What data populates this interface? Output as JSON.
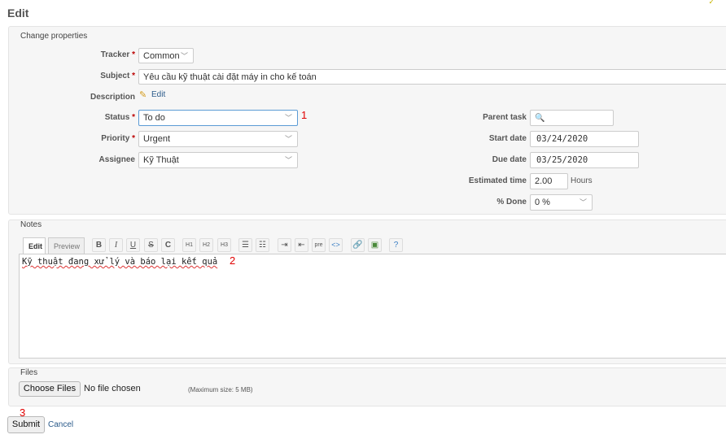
{
  "page": {
    "title": "Edit"
  },
  "properties": {
    "legend": "Change properties",
    "tracker": {
      "label": "Tracker",
      "value": "Common"
    },
    "subject": {
      "label": "Subject",
      "value": "Yêu cầu kỹ thuật cài đặt máy in cho kế toán"
    },
    "description": {
      "label": "Description",
      "edit_link": "Edit"
    },
    "status": {
      "label": "Status",
      "value": "To do"
    },
    "priority": {
      "label": "Priority",
      "value": "Urgent"
    },
    "assignee": {
      "label": "Assignee",
      "value": "Kỹ Thuật"
    },
    "parent_task": {
      "label": "Parent task",
      "value": ""
    },
    "start_date": {
      "label": "Start date",
      "value": "03/24/2020"
    },
    "due_date": {
      "label": "Due date",
      "value": "03/25/2020"
    },
    "estimated_time": {
      "label": "Estimated time",
      "value": "2.00",
      "unit": "Hours"
    },
    "done": {
      "label": "% Done",
      "value": "0 %"
    },
    "required_mark": "*"
  },
  "notes": {
    "legend": "Notes",
    "tabs": [
      "Edit",
      "Preview"
    ],
    "toolbar": {
      "bold": "B",
      "italic": "I",
      "underline": "U",
      "strike": "S",
      "code": "C",
      "h1": "H1",
      "h2": "H2",
      "h3": "H3",
      "pre": "pre"
    },
    "text": "Kỹ thuật đang xử lý và báo lại kết quả"
  },
  "files": {
    "legend": "Files",
    "choose_button": "Choose Files",
    "status": "No file chosen",
    "max_size": "(Maximum size: 5 MB)"
  },
  "actions": {
    "submit": "Submit",
    "cancel": "Cancel"
  },
  "annotations": {
    "a1": "1",
    "a2": "2",
    "a3": "3"
  },
  "colors": {
    "required": "#bb0000",
    "annotation": "#e00000",
    "link": "#2a5a8a"
  }
}
